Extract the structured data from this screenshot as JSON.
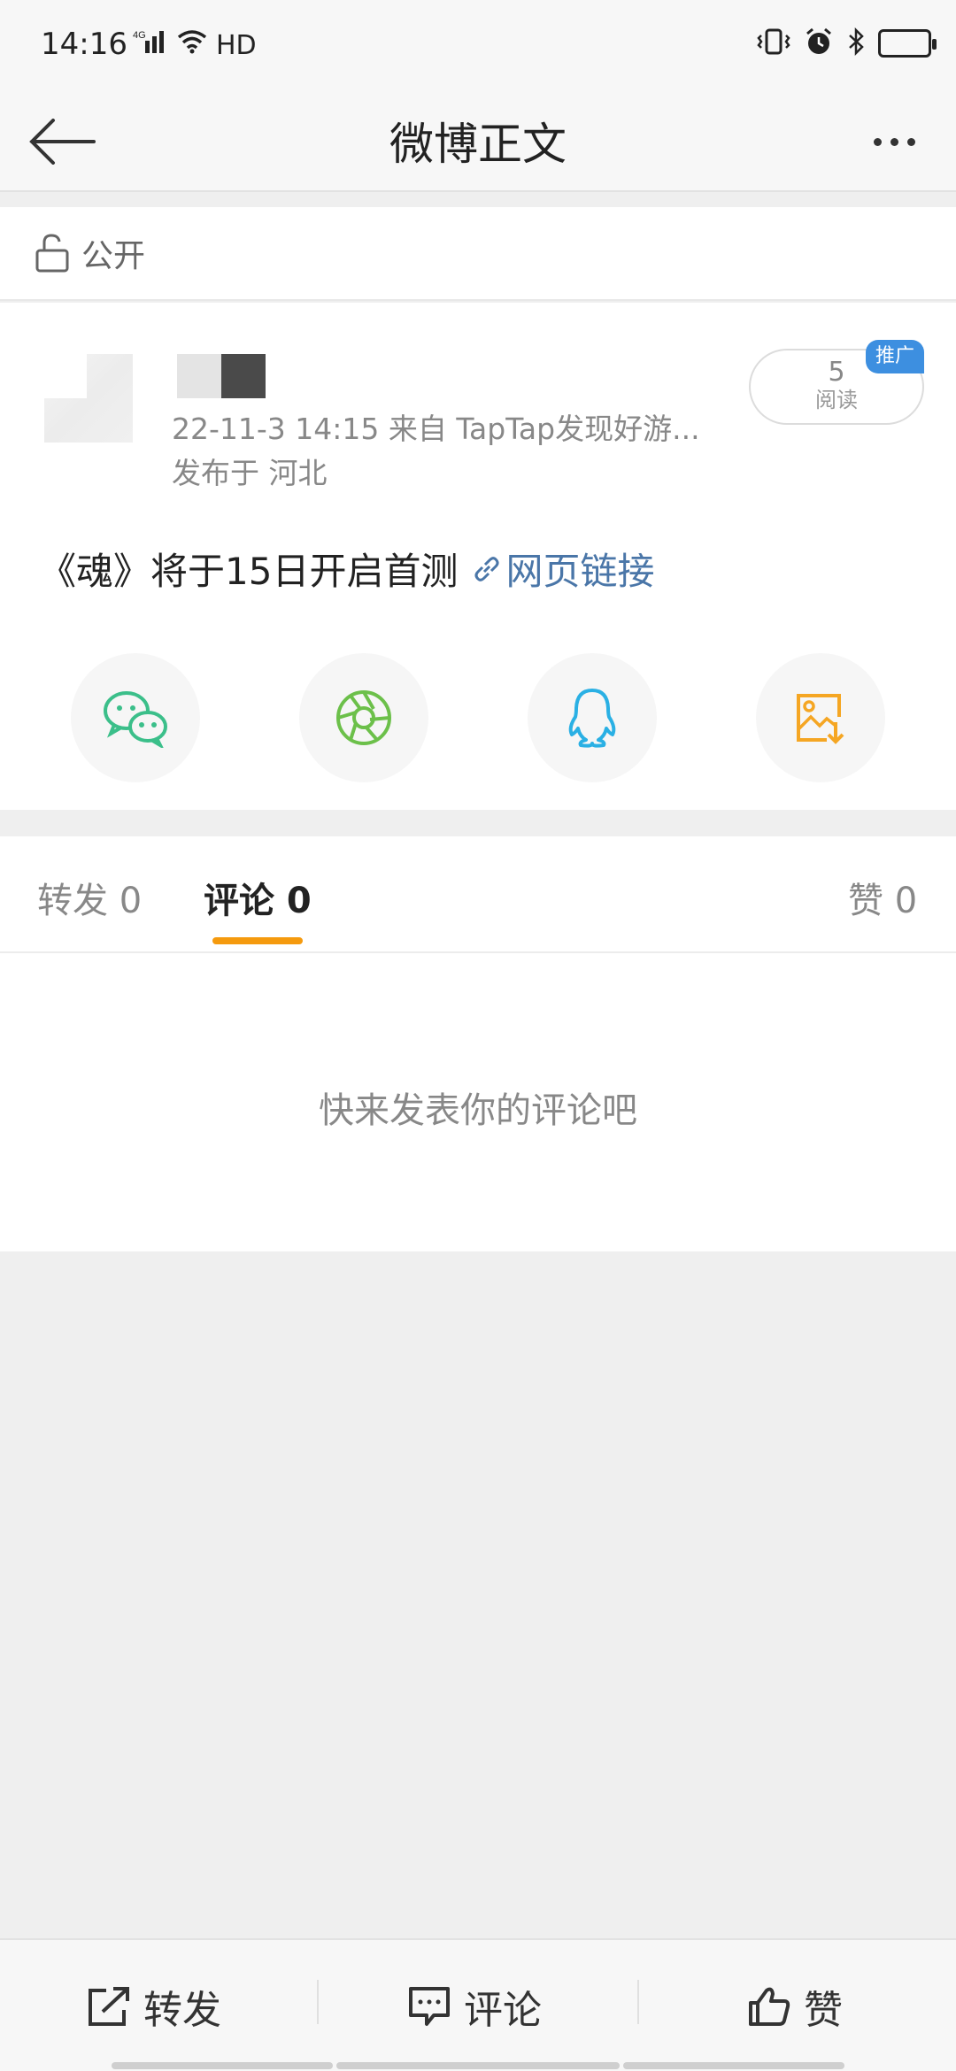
{
  "status_bar": {
    "time": "14:16",
    "network": "4G",
    "hd": "HD",
    "icons": [
      "signal-icon",
      "wifi-icon",
      "vibrate-icon",
      "alarm-icon",
      "bluetooth-icon",
      "battery-icon"
    ],
    "battery_color": "#f6d000"
  },
  "header": {
    "title": "微博正文",
    "back_icon": "arrow-left-icon",
    "more_icon": "more-dots-icon"
  },
  "visibility": {
    "icon": "unlock-icon",
    "label": "公开"
  },
  "post": {
    "meta_line1": "22-11-3 14:15   来自 TapTap发现好游...",
    "meta_line2": "发布于 河北",
    "reads_count": "5",
    "reads_label": "阅读",
    "promo_tag": "推广",
    "text": "《魂》将于15日开启首测",
    "link_text": "网页链接",
    "link_color": "#4a76a8",
    "share_targets": [
      {
        "name": "wechat-icon",
        "color": "#3bbf8a"
      },
      {
        "name": "moments-icon",
        "color": "#6cc04a"
      },
      {
        "name": "qq-icon",
        "color": "#2ab0e4"
      },
      {
        "name": "save-image-icon",
        "color": "#f5a623"
      }
    ]
  },
  "tabs": {
    "repost": "转发 0",
    "comment": "评论 0",
    "like": "赞 0",
    "active": "comment",
    "accent": "#f59a0e"
  },
  "comments": {
    "empty_hint": "快来发表你的评论吧"
  },
  "bottom_bar": {
    "repost": "转发",
    "comment": "评论",
    "like": "赞"
  }
}
